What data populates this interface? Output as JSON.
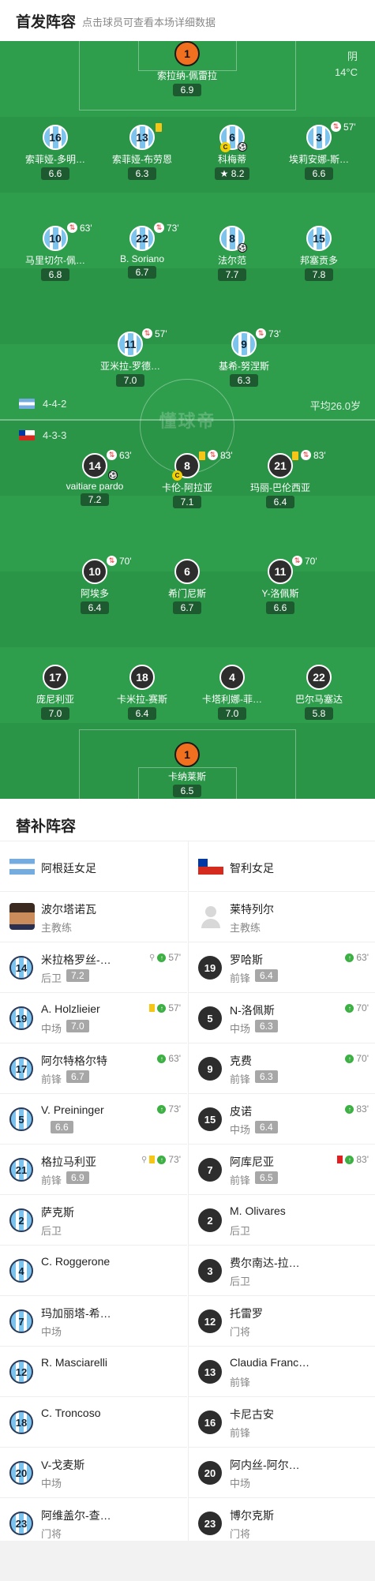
{
  "header": {
    "title": "首发阵容",
    "subtitle": "点击球员可查看本场详细数据"
  },
  "weather": {
    "condition": "阴",
    "temp": "14°C"
  },
  "watermark": "懂球帝",
  "team_home": {
    "formation": "4-4-2",
    "avg_age": "平均26.0岁"
  },
  "team_away": {
    "formation": "4-3-3"
  },
  "home_players": [
    {
      "num": "1",
      "name": "索拉纳-佩雷拉",
      "rating": "6.9",
      "gk": true
    },
    {
      "num": "16",
      "name": "索菲娅-多明…",
      "rating": "6.6"
    },
    {
      "num": "13",
      "name": "索菲娅-布劳恩",
      "rating": "6.3"
    },
    {
      "num": "6",
      "name": "科梅蒂",
      "rating": "8.2"
    },
    {
      "num": "3",
      "name": "埃莉安娜-斯…",
      "rating": "6.6",
      "sub": "57'"
    },
    {
      "num": "10",
      "name": "马里切尔-佩…",
      "rating": "6.8",
      "sub": "63'"
    },
    {
      "num": "22",
      "name": "B. Soriano",
      "rating": "6.7",
      "sub": "73'"
    },
    {
      "num": "8",
      "name": "法尔范",
      "rating": "7.7"
    },
    {
      "num": "15",
      "name": "邦塞贡多",
      "rating": "7.8"
    },
    {
      "num": "11",
      "name": "亚米拉-罗德…",
      "rating": "7.0",
      "sub": "57'"
    },
    {
      "num": "9",
      "name": "基希-努涅斯",
      "rating": "6.3",
      "sub": "73'"
    }
  ],
  "away_players": [
    {
      "num": "14",
      "name": "vaitiare pardo",
      "rating": "7.2",
      "sub": "63'"
    },
    {
      "num": "8",
      "name": "卡伦-阿拉亚",
      "rating": "7.1",
      "sub": "83'"
    },
    {
      "num": "21",
      "name": "玛丽-巴伦西亚",
      "rating": "6.4",
      "sub": "83'"
    },
    {
      "num": "10",
      "name": "阿埃多",
      "rating": "6.4",
      "sub": "70'"
    },
    {
      "num": "6",
      "name": "希门尼斯",
      "rating": "6.7"
    },
    {
      "num": "11",
      "name": "Y-洛佩斯",
      "rating": "6.6",
      "sub": "70'"
    },
    {
      "num": "17",
      "name": "庞尼利亚",
      "rating": "7.0"
    },
    {
      "num": "18",
      "name": "卡米拉-赛斯",
      "rating": "6.4"
    },
    {
      "num": "4",
      "name": "卡塔利娜-菲…",
      "rating": "7.0"
    },
    {
      "num": "22",
      "name": "巴尔马塞达",
      "rating": "5.8"
    },
    {
      "num": "1",
      "name": "卡纳莱斯",
      "rating": "6.5",
      "gk": true
    }
  ],
  "subs": {
    "title": "替补阵容",
    "home_team": "阿根廷女足",
    "away_team": "智利女足",
    "home_coach": {
      "name": "波尔塔诺瓦",
      "role": "主教练"
    },
    "away_coach": {
      "name": "莱特列尔",
      "role": "主教练"
    },
    "home": [
      {
        "num": "14",
        "name": "米拉格罗丝-…",
        "pos": "后卫",
        "rating": "7.2",
        "time": "57'"
      },
      {
        "num": "19",
        "name": "A. Holzlieier",
        "pos": "中场",
        "rating": "7.0",
        "time": "57'"
      },
      {
        "num": "17",
        "name": "阿尔特格尔特",
        "pos": "前锋",
        "rating": "6.7",
        "time": "63'"
      },
      {
        "num": "5",
        "name": "V. Preininger",
        "pos": "",
        "rating": "6.6",
        "time": "73'"
      },
      {
        "num": "21",
        "name": "格拉马利亚",
        "pos": "前锋",
        "rating": "6.9",
        "time": "73'"
      },
      {
        "num": "2",
        "name": "萨克斯",
        "pos": "后卫",
        "rating": "",
        "time": ""
      },
      {
        "num": "4",
        "name": "C. Roggerone",
        "pos": "",
        "rating": "",
        "time": ""
      },
      {
        "num": "7",
        "name": "玛加丽塔-希…",
        "pos": "中场",
        "rating": "",
        "time": ""
      },
      {
        "num": "12",
        "name": "R. Masciarelli",
        "pos": "",
        "rating": "",
        "time": ""
      },
      {
        "num": "18",
        "name": "C. Troncoso",
        "pos": "",
        "rating": "",
        "time": ""
      },
      {
        "num": "20",
        "name": "V-戈麦斯",
        "pos": "中场",
        "rating": "",
        "time": ""
      },
      {
        "num": "23",
        "name": "阿维盖尔-查…",
        "pos": "门将",
        "rating": "",
        "time": ""
      }
    ],
    "away": [
      {
        "num": "19",
        "name": "罗哈斯",
        "pos": "前锋",
        "rating": "6.4",
        "time": "63'"
      },
      {
        "num": "5",
        "name": "N-洛佩斯",
        "pos": "中场",
        "rating": "6.3",
        "time": "70'"
      },
      {
        "num": "9",
        "name": "克费",
        "pos": "前锋",
        "rating": "6.3",
        "time": "70'"
      },
      {
        "num": "15",
        "name": "皮诺",
        "pos": "中场",
        "rating": "6.4",
        "time": "83'"
      },
      {
        "num": "7",
        "name": "阿库尼亚",
        "pos": "前锋",
        "rating": "6.5",
        "time": "83'"
      },
      {
        "num": "2",
        "name": "M. Olivares",
        "pos": "后卫",
        "rating": "",
        "time": ""
      },
      {
        "num": "3",
        "name": "费尔南达-拉…",
        "pos": "后卫",
        "rating": "",
        "time": ""
      },
      {
        "num": "12",
        "name": "托雷罗",
        "pos": "门将",
        "rating": "",
        "time": ""
      },
      {
        "num": "13",
        "name": "Claudia Franc…",
        "pos": "前锋",
        "rating": "",
        "time": ""
      },
      {
        "num": "16",
        "name": "卡尼古安",
        "pos": "前锋",
        "rating": "",
        "time": ""
      },
      {
        "num": "20",
        "name": "阿内丝-阿尔…",
        "pos": "中场",
        "rating": "",
        "time": ""
      },
      {
        "num": "23",
        "name": "博尔克斯",
        "pos": "门将",
        "rating": "",
        "time": ""
      }
    ]
  }
}
